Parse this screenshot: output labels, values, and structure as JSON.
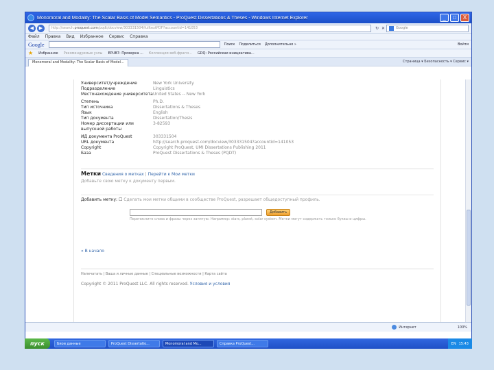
{
  "window": {
    "title": "Monomoral and Modality: The Scalar Basis of Model Semantics - ProQuest Dissertations & Theses - Windows Internet Explorer",
    "controls": [
      "_",
      "□",
      "X"
    ]
  },
  "address": {
    "url_prefix": "http://search.",
    "url_domain": "proquest.com",
    "url_rest": "/pqdt/docview/303331504/fulltextPDF?accountid=141053",
    "search_placeholder": "Google"
  },
  "menu": [
    "Файл",
    "Правка",
    "Вид",
    "Избранное",
    "Сервис",
    "Справка"
  ],
  "google_bar": {
    "logo": "Google",
    "search_label": "Поиск",
    "share": "Поделиться",
    "more": "Дополнительно »",
    "login": "Войти"
  },
  "favorites": {
    "label": "Избранное",
    "items": [
      {
        "text": "Рекомендуемые узлы",
        "muted": true
      },
      {
        "text": "EPUB7: Проверка ...",
        "muted": false
      },
      {
        "text": "Коллекция веб-фрагм...",
        "muted": true
      },
      {
        "text": "GDQ: Российская инициатива...",
        "muted": false
      }
    ]
  },
  "tab": {
    "label": "Monomoral and Modality: The Scalar Basis of Model..."
  },
  "toolbar_right": "Страница ▾  Безопасность ▾  Сервис ▾",
  "details": [
    {
      "k": "Университет/учреждение",
      "v": "New York University"
    },
    {
      "k": "Подразделение",
      "v": "Linguistics"
    },
    {
      "k": "Местонахождение университета",
      "v": "United States -- New York"
    },
    {
      "k": "Степень",
      "v": "Ph.D."
    },
    {
      "k": "Тип источника",
      "v": "Dissertations & Theses"
    },
    {
      "k": "Язык",
      "v": "English"
    },
    {
      "k": "Тип документа",
      "v": "Dissertation/Thesis"
    },
    {
      "k": "Номер диссертации или выпускной работы",
      "v": "3-82593"
    },
    {
      "k": "ИД документа ProQuest",
      "v": "303331504"
    },
    {
      "k": "URL документа",
      "v": "http://search.proquest.com/docview/303331504?accountid=141053"
    },
    {
      "k": "Copyright",
      "v": "Copyright ProQuest, UMI Dissertations Publishing 2011"
    },
    {
      "k": "База",
      "v": "ProQuest Dissertations & Theses (PQDT)"
    }
  ],
  "tags": {
    "title": "Метки",
    "link1": "Сведения о метках",
    "link2": "Перейти к Мои метки",
    "subtitle": "Добавьте свою метку к документу первым."
  },
  "add_tag": {
    "label": "Добавить метку:",
    "description": "Сделать мои метки общими в сообществе ProQuest, разрешает общедоступный профиль.",
    "button": "Добавить",
    "hint": "Перечислите слова и фразы через запятую. Например: stars, planet, solar system. Метки могут содержать только буквы и цифры."
  },
  "back_link": "« В начало",
  "footer_links": "Напечатать  |  Ваша и личные данные  |  Специальные возможности  |  Карта сайта",
  "copyright": {
    "text": "Copyright © 2011 ProQuest LLC. All rights reserved.",
    "link": "Условия и условия"
  },
  "status": {
    "zone": "Интернет",
    "zoom": "100%"
  },
  "taskbar": {
    "start": "пуск",
    "tasks": [
      "Биои данные",
      "ProQuest Dissertatio...",
      "Monomoral and Mo...",
      "Справка ProQuest..."
    ],
    "tray_lang": "EN",
    "time": "15:43"
  }
}
